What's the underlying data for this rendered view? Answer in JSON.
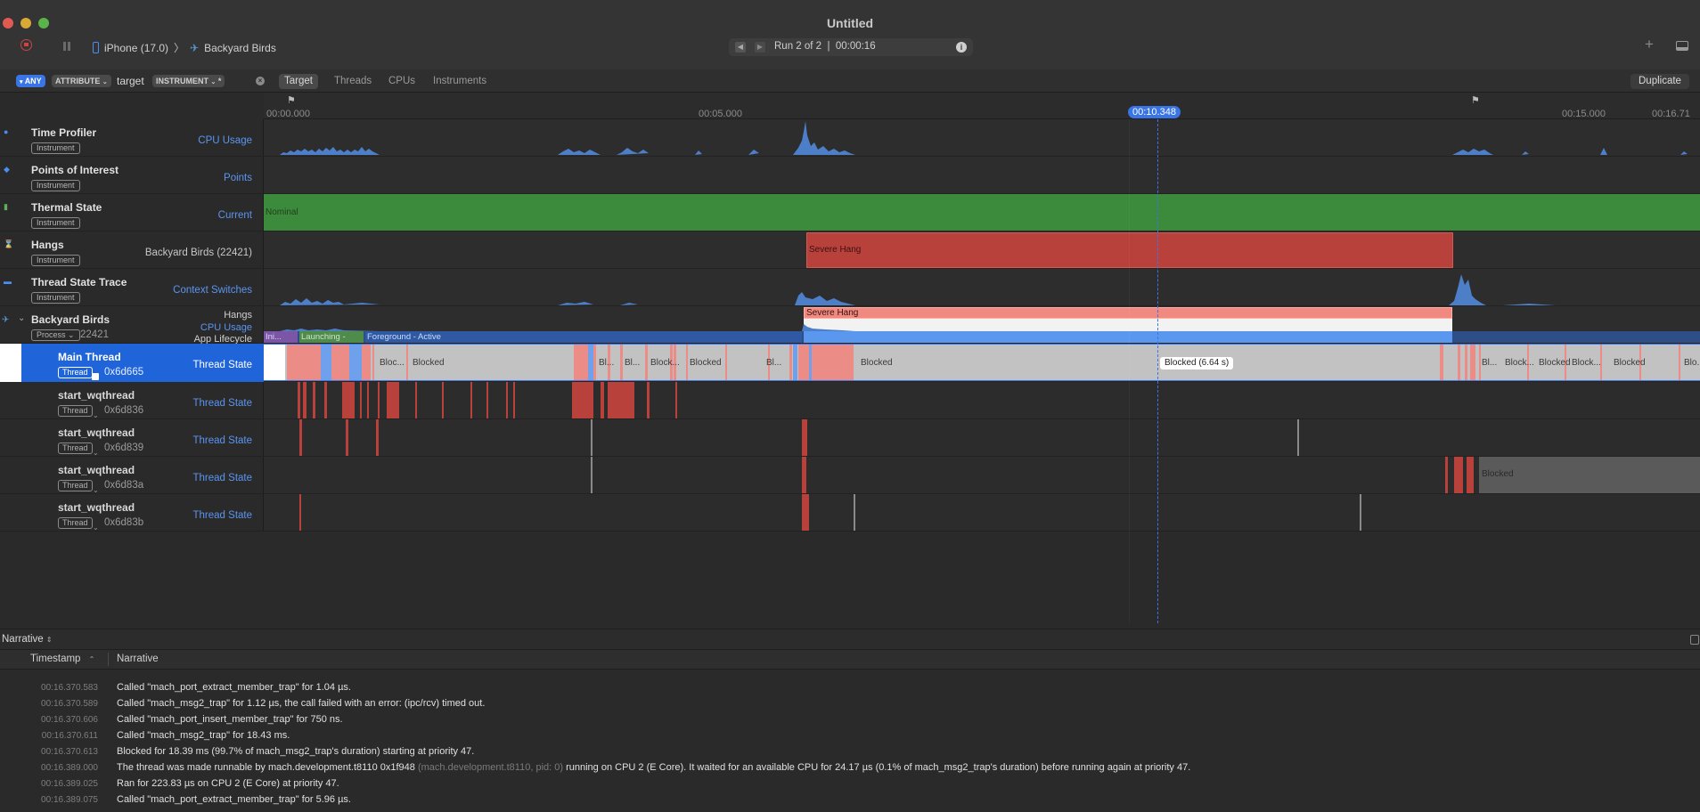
{
  "window": {
    "title": "Untitled",
    "device": "iPhone (17.0)",
    "target_app": "Backyard Birds",
    "run_label": "Run 2 of 2  |  00:00:16"
  },
  "filter_bar": {
    "any_label": "ANY",
    "attribute_label": "ATTRIBUTE",
    "filter_text": "target",
    "instrument_label": "INSTRUMENT",
    "scope_tabs": [
      "Target",
      "Threads",
      "CPUs",
      "Instruments"
    ],
    "active_scope": "Target",
    "duplicate_label": "Duplicate"
  },
  "ruler": {
    "ticks": [
      "00:00.000",
      "00:05.000",
      "00:15.000",
      "00:16.71"
    ],
    "cursor_label": "00:10.348"
  },
  "instruments": [
    {
      "name": "Time Profiler",
      "badge": "Instrument",
      "detail": "CPU Usage"
    },
    {
      "name": "Points of Interest",
      "badge": "Instrument",
      "detail": "Points"
    },
    {
      "name": "Thermal State",
      "badge": "Instrument",
      "detail": "Current",
      "band_label": "Nominal"
    },
    {
      "name": "Hangs",
      "badge": "Instrument",
      "detail": "Backyard Birds (22421)",
      "band_label": "Severe Hang"
    },
    {
      "name": "Thread State Trace",
      "badge": "Instrument",
      "detail": "Context Switches"
    }
  ],
  "process": {
    "name": "Backyard Birds",
    "badge": "Process",
    "pid": "22421",
    "sub_tracks": [
      "Hangs",
      "CPU Usage",
      "App Lifecycle"
    ],
    "hang_label": "Severe Hang",
    "lifecycle": [
      "Ini...",
      "Launching - Ini...",
      "Foreground - Active"
    ]
  },
  "threads": [
    {
      "name": "Main Thread",
      "badge": "Thread",
      "id": "0x6d665",
      "detail": "Thread State",
      "selected": true,
      "labels": [
        "Bloc...",
        "Blocked",
        "Bl...",
        "Bl...",
        "Block...",
        "Blocked",
        "Bl...",
        "Blocked",
        "Bl...",
        "Block...",
        "Blocked",
        "Block...",
        "Blocked",
        "Blo..."
      ],
      "tooltip": "Blocked (6.64 s)"
    },
    {
      "name": "start_wqthread",
      "badge": "Thread",
      "id": "0x6d836",
      "detail": "Thread State"
    },
    {
      "name": "start_wqthread",
      "badge": "Thread",
      "id": "0x6d839",
      "detail": "Thread State"
    },
    {
      "name": "start_wqthread",
      "badge": "Thread",
      "id": "0x6d83a",
      "detail": "Thread State",
      "block_label": "Blocked"
    },
    {
      "name": "start_wqthread",
      "badge": "Thread",
      "id": "0x6d83b",
      "detail": "Thread State"
    }
  ],
  "narrative": {
    "pane_label": "Narrative",
    "col_timestamp": "Timestamp",
    "col_narrative": "Narrative",
    "rows": [
      {
        "ts": "00:16.370.583",
        "text": "Called \"mach_port_extract_member_trap\" for 1.04 µs."
      },
      {
        "ts": "00:16.370.589",
        "text": "Called \"mach_msg2_trap\" for 1.12 µs, the call failed with an error: (ipc/rcv) timed out."
      },
      {
        "ts": "00:16.370.606",
        "text": "Called \"mach_port_insert_member_trap\" for 750 ns."
      },
      {
        "ts": "00:16.370.611",
        "text": "Called \"mach_msg2_trap\" for 18.43 ms."
      },
      {
        "ts": "00:16.370.613",
        "text": "Blocked for 18.39 ms (99.7% of mach_msg2_trap's duration) starting at priority 47."
      },
      {
        "ts": "00:16.389.000",
        "text": "The thread was made runnable by mach.development.t8110  0x1f948",
        "dim": "(mach.development.t8110, pid: 0)",
        "text2": "running on CPU 2 (E Core). It waited for an available CPU for 24.17 µs (0.1% of mach_msg2_trap's duration) before running again at priority 47."
      },
      {
        "ts": "00:16.389.025",
        "text": "Ran for 223.83 µs on CPU 2 (E Core) at priority 47."
      },
      {
        "ts": "00:16.389.075",
        "text": "Called \"mach_port_extract_member_trap\" for 5.96 µs."
      }
    ]
  },
  "colors": {
    "accent": "#3a75e6",
    "thermal": "#3c8a3c",
    "hang": "#b8413c",
    "hang_light": "#f08a80",
    "blocked": "#c2c2c2",
    "cpu_bar": "#4d7fc9"
  }
}
